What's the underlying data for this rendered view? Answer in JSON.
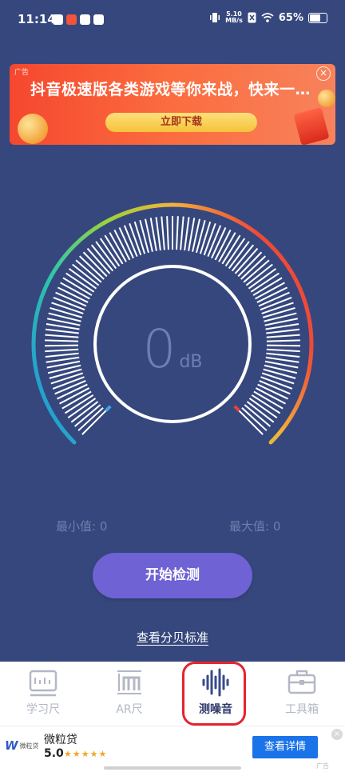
{
  "status_bar": {
    "time": "11:14",
    "net_speed_value": "5.10",
    "net_speed_unit": "MB/s",
    "battery": "65%"
  },
  "top_ad": {
    "tag": "广告",
    "headline": "抖音极速版各类游戏等你来战，快来一…",
    "button": "立即下载"
  },
  "meter": {
    "value": "0",
    "unit": "dB",
    "level_fraction": 0,
    "min_label": "最小值: 0",
    "max_label": "最大值: 0"
  },
  "actions": {
    "start_button": "开始检测",
    "db_standard_link": "查看分贝标准"
  },
  "bottom_nav": {
    "items": [
      {
        "label": "学习尺",
        "icon": "ruler-icon"
      },
      {
        "label": "AR尺",
        "icon": "ar-ruler-icon"
      },
      {
        "label": "测噪音",
        "icon": "sound-wave-icon"
      },
      {
        "label": "工具箱",
        "icon": "toolbox-icon"
      }
    ],
    "active_index": 2
  },
  "bottom_ad": {
    "brand": "微粒贷",
    "logo_text": "微粒贷",
    "rating": "5.0",
    "button": "查看详情",
    "tag": "广告"
  },
  "colors": {
    "background": "#36477d",
    "start_button": "#6e62d4",
    "active_ring": "#e3252f",
    "ad_button": "#1a73e8",
    "gauge_start": "#1f8fe0",
    "gauge_mid": "#9ad43a",
    "gauge_end": "#ef4a38"
  }
}
